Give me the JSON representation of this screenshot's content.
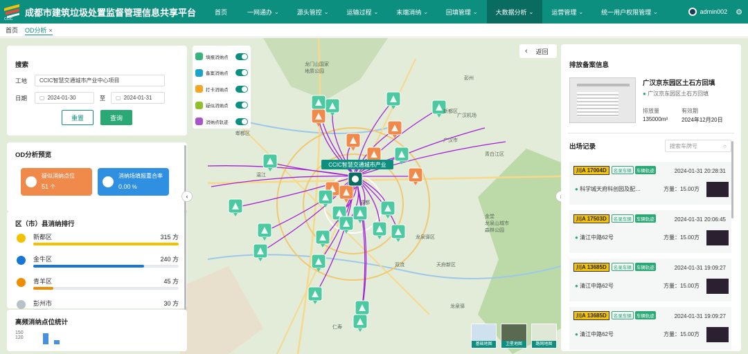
{
  "header": {
    "title": "成都市建筑垃圾处置监督管理信息共享平台",
    "logo_text": "CCIC",
    "nav": [
      {
        "label": "首页",
        "chev": ""
      },
      {
        "label": "一网通办",
        "chev": "⌄"
      },
      {
        "label": "源头管控",
        "chev": "⌄"
      },
      {
        "label": "运输过程",
        "chev": "⌄"
      },
      {
        "label": "末端消纳",
        "chev": "⌄"
      },
      {
        "label": "回填管理",
        "chev": "⌄"
      },
      {
        "label": "大数据分析",
        "chev": "⌄"
      },
      {
        "label": "运营管理",
        "chev": "⌄"
      },
      {
        "label": "统一用户权限管理",
        "chev": "⌄"
      }
    ],
    "active_nav": "大数据分析",
    "user": "admin002"
  },
  "tabs": {
    "home": "首页",
    "current": "OD分析",
    "close": "×"
  },
  "search": {
    "title": "搜索",
    "site_label": "工地",
    "site_value": "CCIC智慧交通城市产业中心项目",
    "date_label": "日期",
    "date_from": "2024-01-30",
    "date_to": "2024-01-31",
    "date_sep": "至",
    "reset": "重置",
    "query": "查询"
  },
  "od": {
    "title": "OD分析预览",
    "card1_label": "疑似消纳点位",
    "card1_value": "51",
    "card1_unit": "个",
    "card2_label": "消纳场填报重合率",
    "card2_value": "0.00",
    "card2_unit": "%"
  },
  "rank": {
    "title": "区（市）县消纳排行",
    "items": [
      {
        "name": "新都区",
        "value": "315",
        "unit": "方",
        "pct": 100,
        "color": "#f2c200",
        "medal": "#f2c200"
      },
      {
        "name": "金牛区",
        "value": "240",
        "unit": "方",
        "pct": 76,
        "color": "#1877d6",
        "medal": "#1877d6"
      },
      {
        "name": "青羊区",
        "value": "45",
        "unit": "方",
        "pct": 14,
        "color": "#f08c00",
        "medal": "#f08c00"
      },
      {
        "name": "彭州市",
        "value": "30",
        "unit": "方",
        "pct": 10,
        "color": "#d0d4d8",
        "medal": "#b8c0c8"
      }
    ]
  },
  "hf": {
    "title": "高频消纳点位统计",
    "ticks": [
      "150",
      "120"
    ]
  },
  "legend": [
    {
      "label": "填报消纳点",
      "color": "#36b37e"
    },
    {
      "label": "备案消纳点",
      "color": "#1aa3c8"
    },
    {
      "label": "打卡消纳点",
      "color": "#f5a623"
    },
    {
      "label": "疑似消纳点",
      "color": "#8fbf2a"
    },
    {
      "label": "消纳点轨迹",
      "color": "#a855c8"
    }
  ],
  "map": {
    "back": "返回",
    "center_label": "CCIC智慧交通城市产业",
    "basemaps": [
      "基础地图",
      "卫星地图",
      "路网地图"
    ],
    "places": [
      "龙门山国家",
      "地质公园",
      "彭州",
      "新都区",
      "广汉机场",
      "广汉市",
      "青白江区",
      "金堂",
      "龙泉驿区",
      "双流",
      "天府新区",
      "温江",
      "郫都区",
      "成都",
      "龙泉山城市",
      "森林公园",
      "龙泉驿",
      "仁寿"
    ]
  },
  "beian": {
    "title": "排放备案信息",
    "name": "广汉京东园区土石方回填",
    "address": "广汉京东园区土石方回填",
    "vol_label": "排放量",
    "vol_value": "135000m³",
    "valid_label": "有效期",
    "valid_value": "2024年12月20日"
  },
  "records": {
    "title": "出场记录",
    "search_placeholder": "搜索车牌号",
    "tag_a": "名录车辆",
    "tag_b": "车辆轨迹",
    "amount_label": "方量：",
    "items": [
      {
        "plate": "川A 17004D",
        "time": "2024-01-31 20:28:31",
        "addr": "科学城天府科创园及配…",
        "amount": "15.00方"
      },
      {
        "plate": "川A 17503D",
        "time": "2024-01-31 20:06:45",
        "addr": "清江中路62号",
        "amount": "15.00方"
      },
      {
        "plate": "川A 13685D",
        "time": "2024-01-31 19:09:27",
        "addr": "清江中路62号",
        "amount": "15.00方"
      },
      {
        "plate": "川A 13685D",
        "time": "2024-01-31 19:09:27",
        "addr": "清江中路62号",
        "amount": "15.00方"
      }
    ]
  }
}
